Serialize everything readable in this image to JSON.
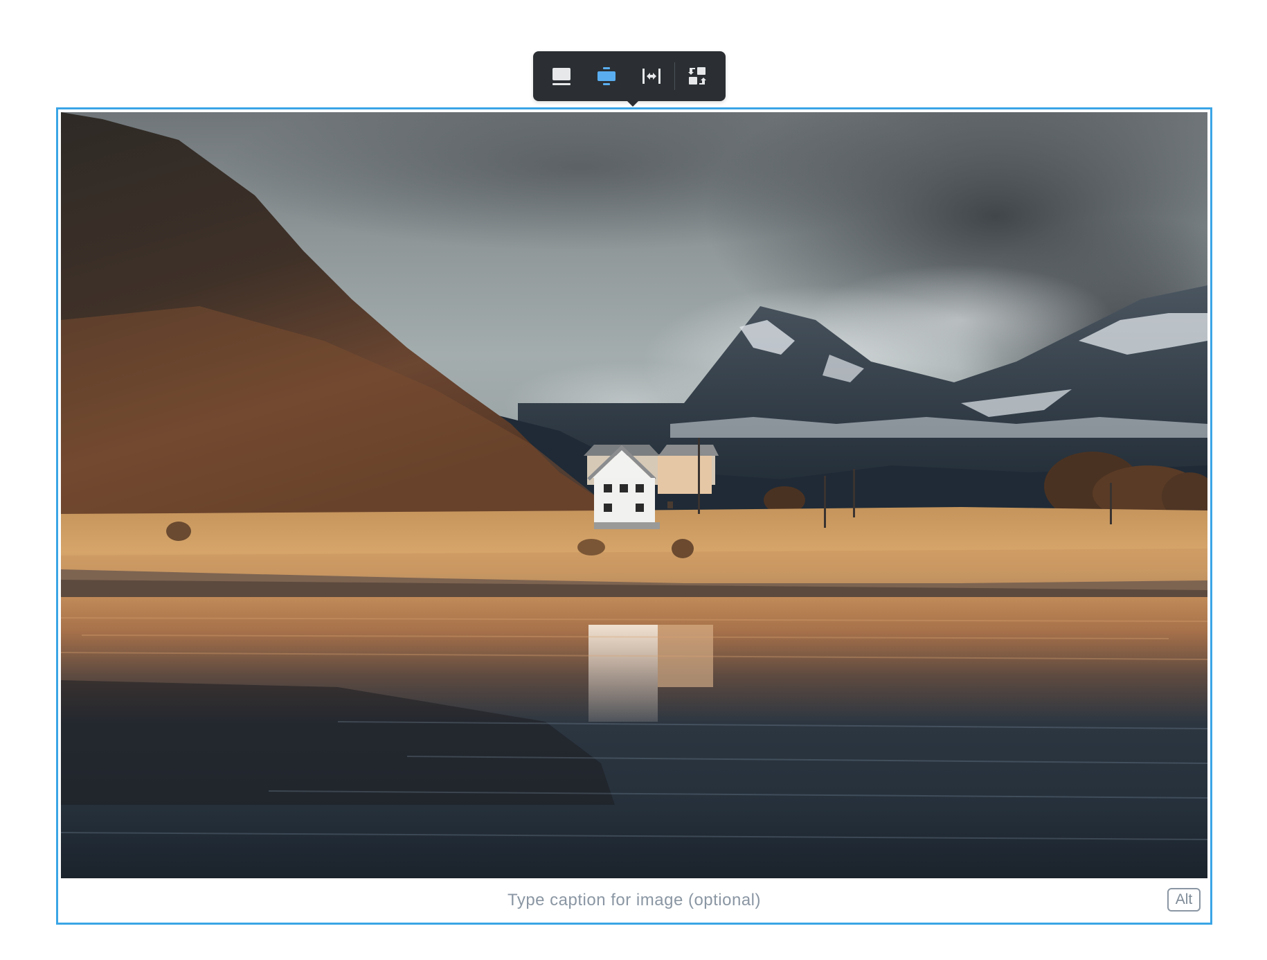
{
  "toolbar": {
    "buttons": [
      {
        "icon": "full-width-image-icon",
        "active": false
      },
      {
        "icon": "center-image-icon",
        "active": true
      },
      {
        "icon": "side-image-icon",
        "active": false
      },
      {
        "icon": "replace-image-icon",
        "active": false
      }
    ],
    "active_color": "#5aaef0",
    "icon_color": "#e6e8ea"
  },
  "image": {
    "subject": "landscape-photo"
  },
  "caption": {
    "placeholder": "Type caption for image (optional)"
  },
  "alt_button": {
    "label": "Alt"
  },
  "colors": {
    "selection_border": "#3aa5e6",
    "toolbar_bg": "#2b2f33",
    "caption_text": "#8a96a3"
  }
}
